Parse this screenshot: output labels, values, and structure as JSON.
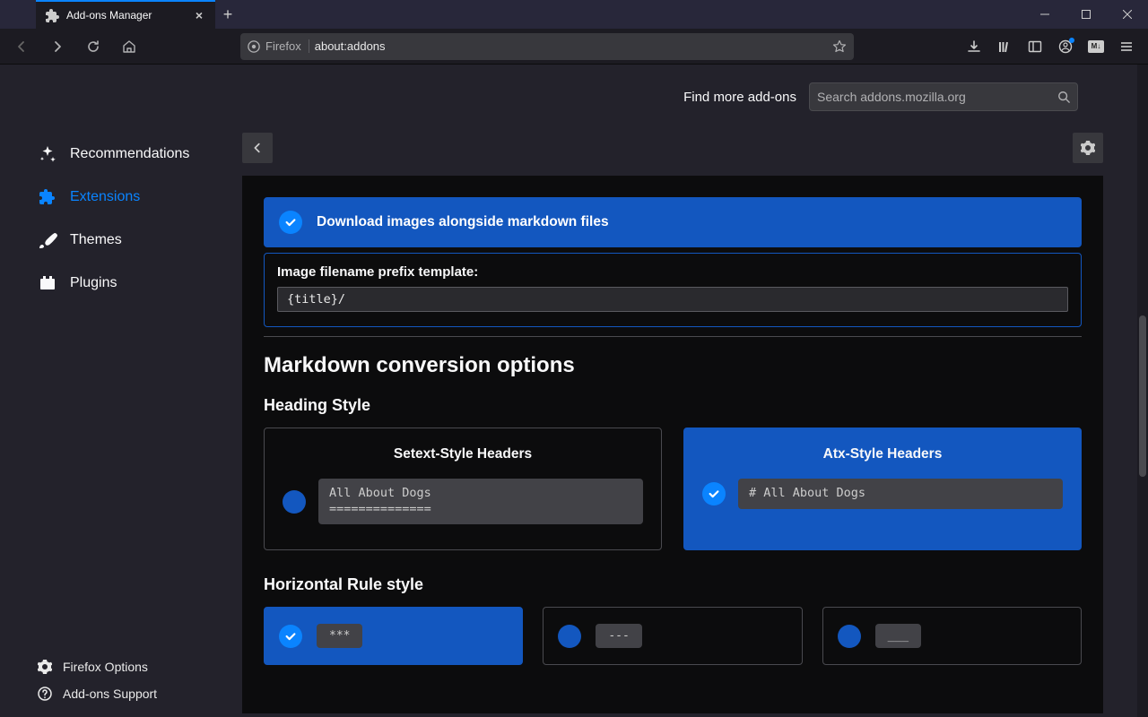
{
  "window": {
    "tab_title": "Add-ons Manager"
  },
  "urlbar": {
    "identity": "Firefox",
    "url": "about:addons"
  },
  "find": {
    "label": "Find more add-ons",
    "placeholder": "Search addons.mozilla.org"
  },
  "sidebar": {
    "items": [
      {
        "label": "Recommendations"
      },
      {
        "label": "Extensions"
      },
      {
        "label": "Themes"
      },
      {
        "label": "Plugins"
      }
    ],
    "footer": [
      {
        "label": "Firefox Options"
      },
      {
        "label": "Add-ons Support"
      }
    ]
  },
  "options": {
    "download_images_label": "Download images alongside markdown files",
    "prefix_label": "Image filename prefix template:",
    "prefix_value": "{title}/",
    "section_title": "Markdown conversion options",
    "heading_style_title": "Heading Style",
    "heading_choices": [
      {
        "title": "Setext-Style Headers",
        "sample": "All About Dogs\n=============="
      },
      {
        "title": "Atx-Style Headers",
        "sample": "# All About Dogs"
      }
    ],
    "hr_title": "Horizontal Rule style",
    "hr_choices": [
      {
        "sample": "***"
      },
      {
        "sample": "---"
      },
      {
        "sample": "___"
      }
    ]
  }
}
